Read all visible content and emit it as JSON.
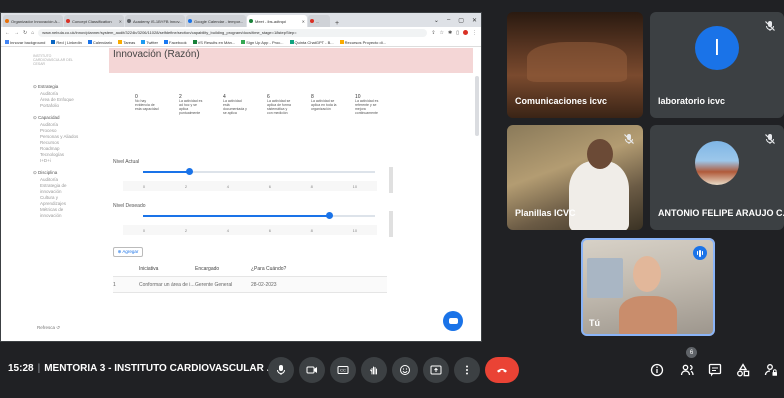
{
  "browser": {
    "tabs": [
      {
        "label": "Organizador Innovación A..."
      },
      {
        "label": "Concept Classification"
      },
      {
        "label": "Academy IS-1BYFB Innov..."
      },
      {
        "label": "Google Calendar - tempor..."
      },
      {
        "label": "Meet - ibs-adtrqoi"
      },
      {
        "label": "..."
      }
    ],
    "url": "www.nebula.co.uk/innov/planner/system_audit/3224b/3206/11028/selfdefine/section/capability_building_program/docs/time_stage=18stepStep=",
    "bookmarks": [
      "Innovar background",
      "Red | Linkedin",
      "Calendario",
      "Tareas",
      "Twitter",
      "Facebook",
      "VS Results en Mán...",
      "Sign Up App - Proc...",
      "Quinta ChatGPT - B...",
      "Recursos Proyecto di..."
    ]
  },
  "app": {
    "logo_text": "INSTITUTO CARDIOVASCULAR DEL CESAR",
    "sidebar": [
      {
        "head": "Estrategia",
        "items": [
          "Auditoría",
          "Área de Enfoque",
          "Portafolio"
        ]
      },
      {
        "head": "Capacidad",
        "items": [
          "Auditoría",
          "Proceso",
          "Personas y Aliados",
          "Recursos",
          "Roadmap",
          "Tecnologías",
          "I+D+i"
        ]
      },
      {
        "head": "Disciplina",
        "items": [
          "Auditoría",
          "Estrategia de innovación",
          "Cultura y Aprendizajes",
          "Métricas de innovación"
        ]
      }
    ],
    "refresh_label": "Refresca ↺",
    "banner_title": "Innovación (Razón)",
    "steps": [
      {
        "num": "0",
        "text": "No hay evidencia de esta capacidad"
      },
      {
        "num": "2",
        "text": "La actividad es ad hoc y se aplica puntualmente"
      },
      {
        "num": "4",
        "text": "La actividad está documentada y se aplica"
      },
      {
        "num": "6",
        "text": "La actividad se aplica de forma sistemática y con medición"
      },
      {
        "num": "8",
        "text": "La actividad se aplica en toda la organización"
      },
      {
        "num": "10",
        "text": "La actividad es referente y se mejora continuamente"
      }
    ],
    "slider_actual": {
      "label": "Nivel Actual",
      "value": 2,
      "max": 10,
      "ticks": [
        "0",
        "2",
        "4",
        "6",
        "8",
        "10"
      ]
    },
    "slider_deseado": {
      "label": "Nivel Deseado",
      "value": 8,
      "max": 10,
      "ticks": [
        "0",
        "2",
        "4",
        "6",
        "8",
        "10"
      ]
    },
    "add_label": "⊕ Agregar",
    "table": {
      "headers": [
        "",
        "Iniciativa",
        "Encargado",
        "¿Para Cuándo?"
      ],
      "rows": [
        {
          "idx": "1",
          "iniciativa": "Conformar un área de i...",
          "encargado": "Gerente General",
          "fecha": "28-02-2023"
        }
      ]
    }
  },
  "participants": [
    {
      "name": "Comunicaciones icvc",
      "muted": false,
      "type": "video"
    },
    {
      "name": "laboratorio icvc",
      "muted": true,
      "type": "letter",
      "letter": "l"
    },
    {
      "name": "Planillas ICVC",
      "muted": true,
      "type": "video"
    },
    {
      "name": "ANTONIO FELIPE ARAUJO C...",
      "muted": true,
      "type": "photo"
    },
    {
      "name": "Tú",
      "muted": false,
      "type": "video",
      "speaking": true
    }
  ],
  "meeting": {
    "time": "15:28",
    "title": "MENTORIA 3 - INSTITUTO CARDIOVASCULAR ...",
    "people_count": "6"
  },
  "colors": {
    "accent": "#1a73e8",
    "hangup": "#ea4335",
    "bar_bg": "#202124",
    "tile_bg": "#3c4043",
    "banner": "#f4d6d6"
  }
}
